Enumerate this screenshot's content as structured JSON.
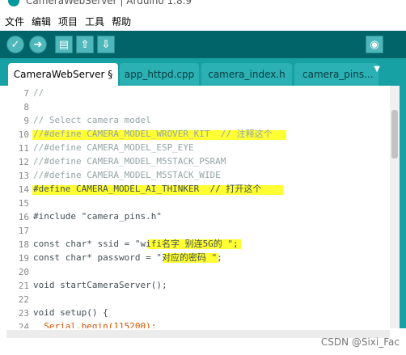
{
  "window": {
    "title": "CameraWebServer | Arduino 1.8.9"
  },
  "menu": {
    "items": [
      "文件",
      "编辑",
      "项目",
      "工具",
      "帮助"
    ]
  },
  "toolbar": {
    "verify_icon": "check-icon",
    "upload_icon": "arrow-right-icon",
    "new_icon": "new-file-icon",
    "open_icon": "arrow-up-icon",
    "save_icon": "arrow-down-icon",
    "serial_icon": "magnifier-icon"
  },
  "tabs": [
    {
      "label": "CameraWebServer §",
      "active": true
    },
    {
      "label": "app_httpd.cpp",
      "active": false
    },
    {
      "label": "camera_index.h",
      "active": false
    },
    {
      "label": "camera_pins...",
      "active": false
    }
  ],
  "editor": {
    "lines": [
      {
        "num": "7",
        "text": "//"
      },
      {
        "num": "8",
        "text": ""
      },
      {
        "num": "9",
        "text": "// Select camera model"
      },
      {
        "num": "10",
        "text": "//#define CAMERA_MODEL_WROVER_KIT  // 注释这个"
      },
      {
        "num": "11",
        "text": "//#define CAMERA_MODEL_ESP_EYE"
      },
      {
        "num": "12",
        "text": "//#define CAMERA_MODEL_M5STACK_PSRAM"
      },
      {
        "num": "13",
        "text": "//#define CAMERA_MODEL_M5STACK_WIDE"
      },
      {
        "num": "14",
        "text": "#define CAMERA_MODEL_AI_THINKER  // 打开这个"
      },
      {
        "num": "15",
        "text": ""
      },
      {
        "num": "16",
        "text": "#include \"camera_pins.h\""
      },
      {
        "num": "17",
        "text": ""
      },
      {
        "num": "18",
        "text": "const char* ssid = \"wifi名字 别连5G的 \";"
      },
      {
        "num": "19",
        "text": "const char* password = \"对应的密码 \";"
      },
      {
        "num": "20",
        "text": ""
      },
      {
        "num": "21",
        "text": "void startCameraServer();"
      },
      {
        "num": "22",
        "text": ""
      },
      {
        "num": "23",
        "text": "void setup() {"
      },
      {
        "num": "24",
        "text": "  Serial.begin(115200);"
      }
    ]
  },
  "highlight_color": "#ffff33",
  "accent_color": "#17a1a5",
  "watermark": "CSDN @Sixi_Fac"
}
